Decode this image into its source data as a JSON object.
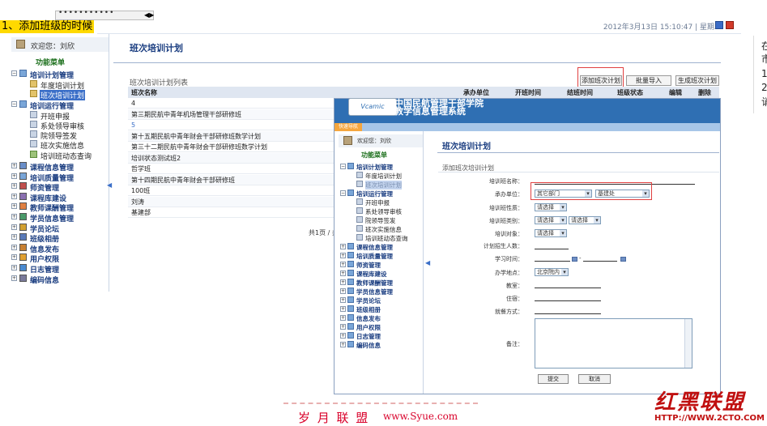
{
  "top": {
    "dots": "•••••••••••",
    "annotation": "1、添加班级的时候",
    "datetime": "2012年3月13日 15:10:47 | 星期二"
  },
  "right_cut": [
    "在",
    "市",
    "1",
    "2",
    "诮"
  ],
  "sidebar": {
    "welcome": "欢迎您：刘欣",
    "menu_title": "功能菜单",
    "groups": [
      {
        "label": "培训计划管理",
        "expanded": true,
        "items": [
          "年度培训计划",
          "班次培训计划"
        ]
      },
      {
        "label": "培训运行管理",
        "expanded": true,
        "items": [
          "开班申报",
          "系处领导审核",
          "院领导签发",
          "班次实施信息",
          "培训班动态查询"
        ]
      },
      {
        "label": "课程信息管理"
      },
      {
        "label": "培训质量管理"
      },
      {
        "label": "师资管理"
      },
      {
        "label": "课程库建设"
      },
      {
        "label": "教师课酬管理"
      },
      {
        "label": "学员信息管理"
      },
      {
        "label": "学员论坛"
      },
      {
        "label": "班级相册"
      },
      {
        "label": "信息发布"
      },
      {
        "label": "用户权限"
      },
      {
        "label": "日志管理"
      },
      {
        "label": "编码信息"
      }
    ],
    "selected": "班次培训计划"
  },
  "main": {
    "title": "班次培训计划",
    "list_title": "班次培训计划列表",
    "buttons": {
      "add": "添加班次计划",
      "import": "批量导入",
      "generate": "生成班次计划"
    },
    "columns": [
      "班次名称",
      "承办单位",
      "开班时间",
      "结班时间",
      "班级状态",
      "编辑",
      "删除"
    ],
    "rows": [
      "4",
      "第三期民航中青年机场管理干部研修班",
      "5",
      "第十五期民航中青年财会干部研修班数学计划",
      "第三十二期民航中青年财会干部研修班数学计划",
      "培训状态测试班2",
      "哲学班",
      "第十四期民航中青年财会干部研修班",
      "100班",
      "刘涛",
      "基建部"
    ],
    "pager": "共1页 / 共"
  },
  "overlay": {
    "logo": "Vcamic",
    "title1": "中国民航管理干部学院",
    "title2": "教学信息管理系统",
    "quick_nav": "快速导航",
    "welcome": "欢迎您：刘欣",
    "menu_title": "功能菜单",
    "page_title": "班次培训计划",
    "section_title": "添加班次培训计划",
    "form": {
      "class_name_label": "培训班名称：",
      "organizer_label": "承办单位：",
      "organizer_value1": "其它部门",
      "organizer_value2": "基建处",
      "nature_label": "培训班性质：",
      "nature_value": "请选择",
      "category_label": "培训班类别：",
      "category_value1": "请选择",
      "category_value2": "请选择",
      "target_label": "培训对象：",
      "target_value": "请选择",
      "enrollment_label": "计划招生人数：",
      "study_time_label": "学习时间：",
      "study_time_sep": "-",
      "location_label": "办学地点：",
      "location_value": "北京院内",
      "classroom_label": "教室：",
      "lodging_label": "住宿：",
      "dining_label": "就餐方式：",
      "remark_label": "备注：",
      "submit": "提交",
      "cancel": "取消"
    }
  },
  "watermarks": {
    "left_cn": "岁 月 联 盟",
    "left_url": "www.Syue.com",
    "right_cn": "红黑联盟",
    "right_url": "HTTP://WWW.2CTO.COM"
  },
  "colors": {
    "accent": "#1a3d80",
    "header_blue": "#2f6fb3",
    "highlight_red": "#e04040",
    "annotation_bg": "#ffd900"
  }
}
